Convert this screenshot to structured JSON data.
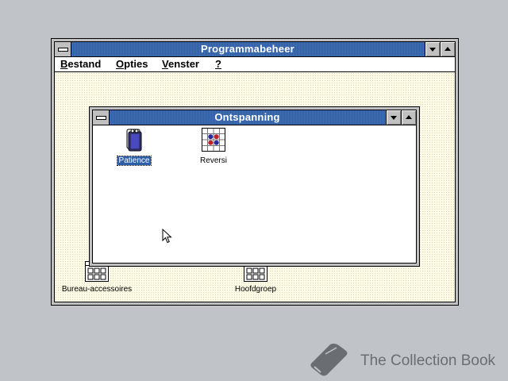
{
  "program_manager": {
    "title": "Programmabeheer",
    "menu": [
      {
        "mnemonic": "B",
        "rest": "estand"
      },
      {
        "mnemonic": "O",
        "rest": "pties"
      },
      {
        "mnemonic": "V",
        "rest": "enster"
      },
      {
        "mnemonic": "?",
        "rest": ""
      }
    ],
    "group_icons": [
      {
        "label": "Bureau-accessoires",
        "icon": "program-group-icon"
      },
      {
        "label": "Hoofdgroep",
        "icon": "program-group-icon"
      }
    ]
  },
  "group_window": {
    "title": "Ontspanning",
    "items": [
      {
        "label": "Patience",
        "icon": "patience-icon",
        "selected": true
      },
      {
        "label": "Reversi",
        "icon": "reversi-icon",
        "selected": false
      }
    ]
  },
  "watermark": {
    "text": "The Collection Book",
    "icon": "book-icon"
  },
  "colors": {
    "titlebar": "#2e5fa6",
    "desktop": "#c0c3c7",
    "client": "#fdfbe6"
  }
}
